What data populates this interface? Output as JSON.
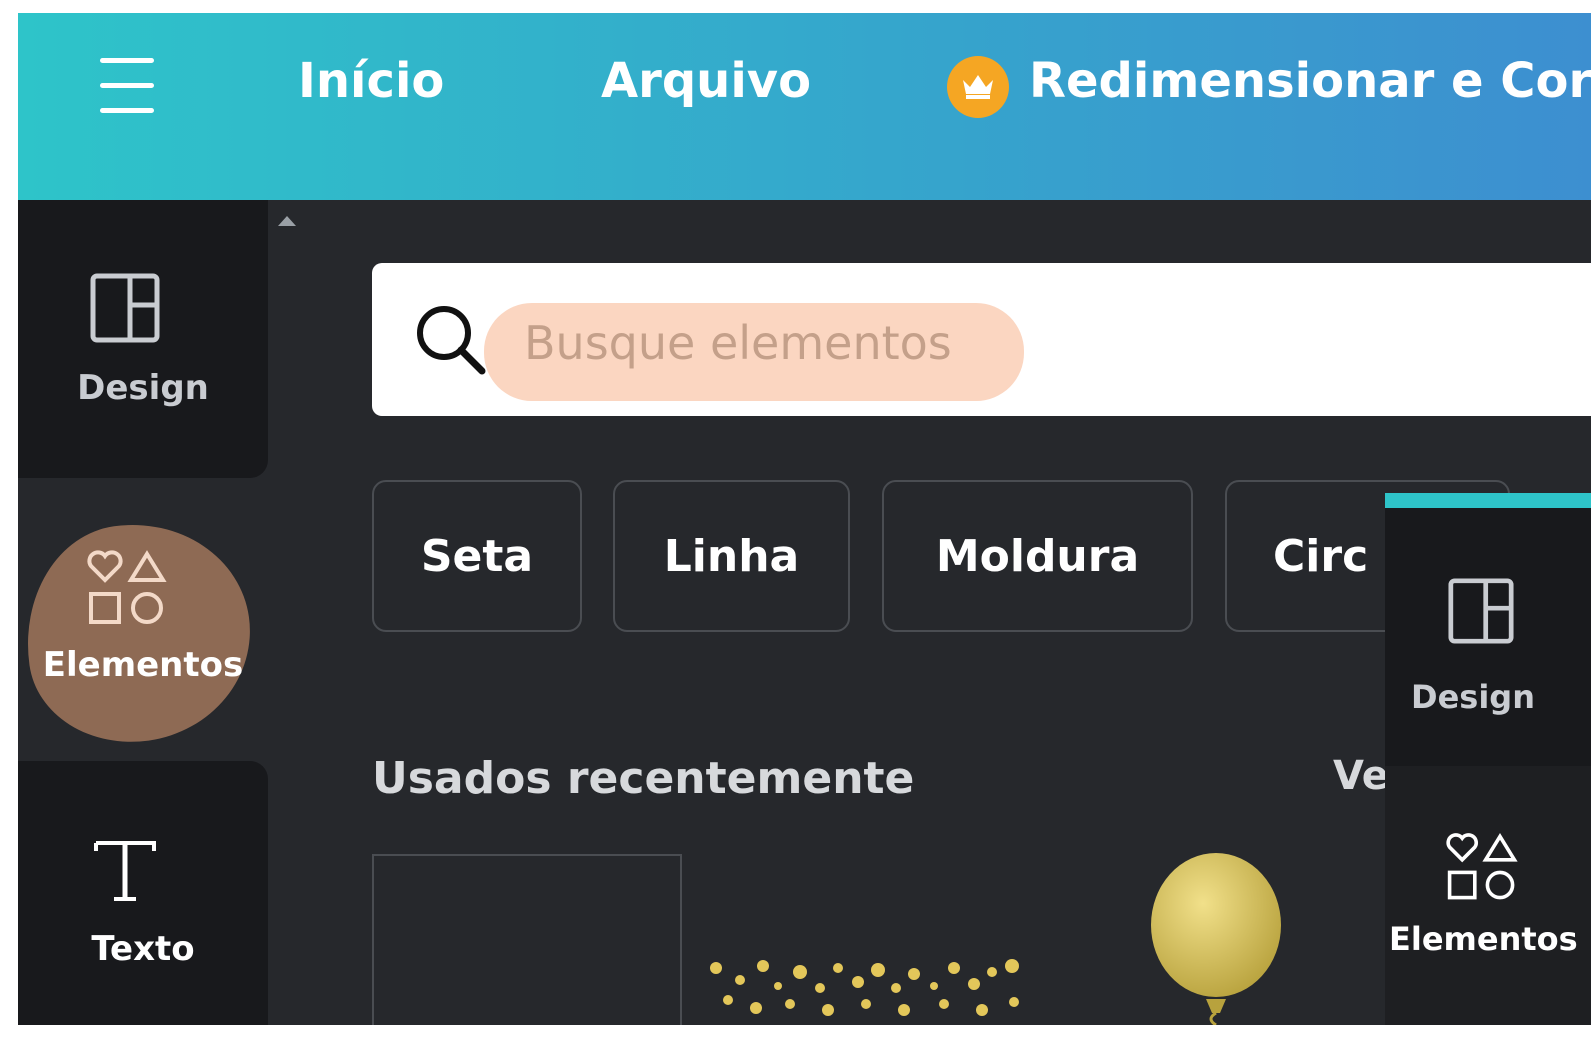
{
  "header": {
    "menu": [
      "Início",
      "Arquivo",
      "Redimensionar e Cor"
    ],
    "colors": {
      "gradient_start": "#2ec4c9",
      "gradient_end": "#3d8fd0",
      "crown_badge": "#f5a623"
    }
  },
  "sidebar": {
    "items": [
      {
        "label": "Design",
        "icon": "layout-icon"
      },
      {
        "label": "Elementos",
        "icon": "shapes-icon",
        "active": true
      },
      {
        "label": "Texto",
        "icon": "text-icon"
      }
    ]
  },
  "search": {
    "placeholder": "Busque elementos",
    "value": ""
  },
  "chips": [
    "Seta",
    "Linha",
    "Moldura",
    "Circ"
  ],
  "recent": {
    "title": "Usados recentemente",
    "see_all": "Ve"
  },
  "overlay": {
    "items": [
      {
        "label": "Design"
      },
      {
        "label": "Elementos"
      }
    ]
  }
}
